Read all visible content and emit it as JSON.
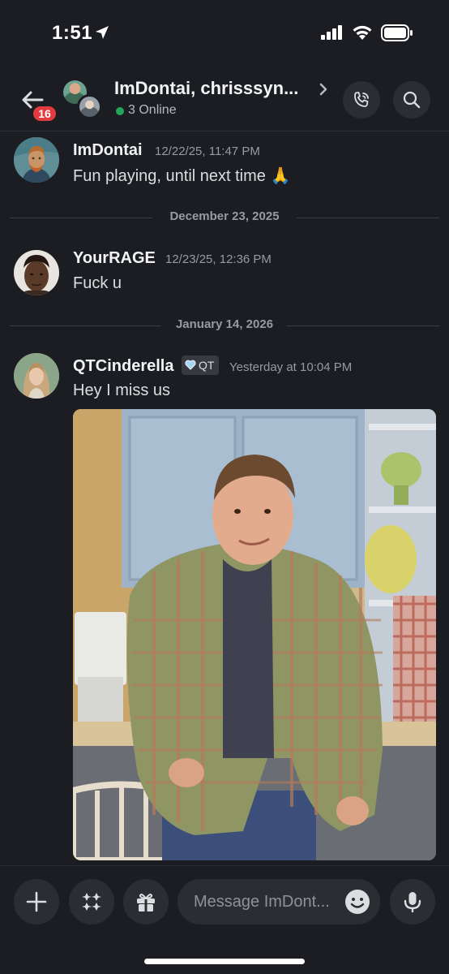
{
  "status_bar": {
    "time": "1:51",
    "icons": [
      "location-arrow-icon",
      "signal-icon",
      "wifi-icon",
      "battery-icon"
    ]
  },
  "header": {
    "unread_badge": "16",
    "title": "ImDontai, chrisssyn...",
    "online_status": "3 Online",
    "icons": [
      "back-arrow-icon",
      "chevron-right-icon",
      "voice-call-icon",
      "search-icon"
    ]
  },
  "messages": [
    {
      "username": "ImDontai",
      "timestamp": "12/22/25, 11:47 PM",
      "text": "Fun playing, until next time 🙏"
    },
    {
      "username": "YourRAGE",
      "timestamp": "12/23/25, 12:36 PM",
      "text": "Fuck u"
    },
    {
      "username": "QTCinderella",
      "tag": "QT",
      "timestamp": "Yesterday at 10:04 PM",
      "text": "Hey I miss us"
    }
  ],
  "dividers": [
    "December 23, 2025",
    "January 14, 2026"
  ],
  "composer": {
    "placeholder": "Message ImDont...",
    "icons": [
      "plus-icon",
      "apps-icon",
      "gift-icon",
      "emoji-icon",
      "microphone-icon"
    ]
  },
  "colors": {
    "background": "#1c1d22",
    "button_bg": "#2b2d33",
    "badge": "#e23b3f",
    "online": "#23a55a",
    "muted_text": "#949ba4"
  }
}
